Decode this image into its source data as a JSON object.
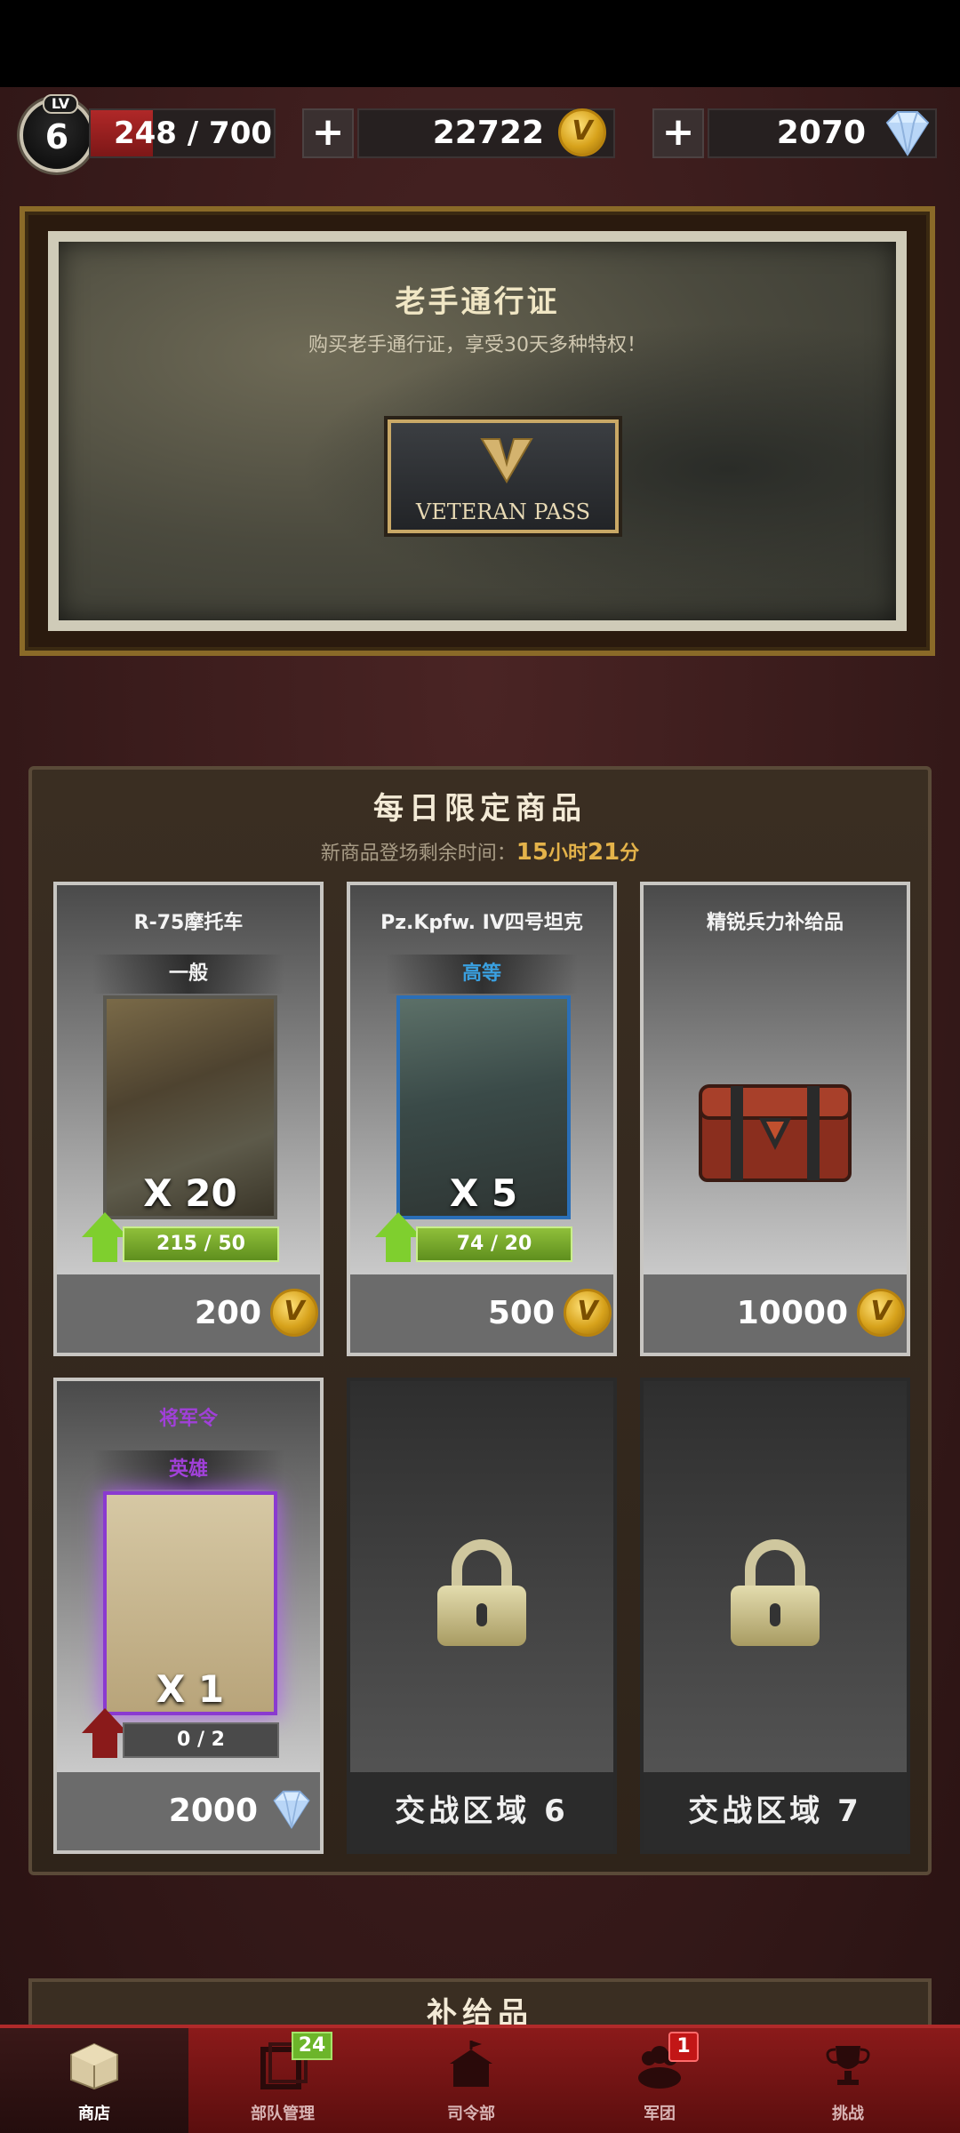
{
  "player": {
    "level_tag": "LV",
    "level": "6",
    "exp": "248 / 700",
    "exp_fraction": 0.354
  },
  "resources": {
    "plus_label": "+",
    "coins": "22722",
    "gems": "2070",
    "coin_icon": "coin-icon",
    "gem_icon": "diamond-icon"
  },
  "veteran_pass": {
    "title": "老手通行证",
    "subtitle": "购买老手通行证，享受30天多种特权！",
    "logo_text": "VETERAN PASS"
  },
  "daily": {
    "title": "每日限定商品",
    "timer_prefix": "新商品登场剩余时间：",
    "timer_hours": "15",
    "timer_h_unit": "小时",
    "timer_minutes": "21",
    "timer_m_unit": "分",
    "items": [
      {
        "name": "R-75摩托车",
        "rank": "一般",
        "rank_color": "#f0f0f0",
        "qty": "X 20",
        "progress": "215 / 50",
        "price": "200",
        "currency": "coin-icon"
      },
      {
        "name": "Pz.Kpfw. IV四号坦克",
        "rank": "高等",
        "rank_color": "#3aa0e0",
        "qty": "X 5",
        "progress": "74 / 20",
        "price": "500",
        "currency": "coin-icon"
      },
      {
        "name": "精锐兵力补给品",
        "price": "10000",
        "currency": "coin-icon"
      },
      {
        "name": "将军令",
        "rank": "英雄",
        "rank_color": "#a040d8",
        "qty": "X 1",
        "progress": "0 / 2",
        "price": "2000",
        "currency": "diamond-icon"
      },
      {
        "zone": "交战区域",
        "zone_num": "6"
      },
      {
        "zone": "交战区域",
        "zone_num": "7"
      }
    ]
  },
  "supply": {
    "title": "补给品"
  },
  "nav": {
    "items": [
      {
        "label": "商店",
        "icon": "box-icon"
      },
      {
        "label": "部队管理",
        "icon": "squad-icon",
        "badge": "24"
      },
      {
        "label": "司令部",
        "icon": "hq-icon"
      },
      {
        "label": "军团",
        "icon": "legion-icon",
        "badge": "1"
      },
      {
        "label": "挑战",
        "icon": "trophy-icon"
      }
    ]
  }
}
